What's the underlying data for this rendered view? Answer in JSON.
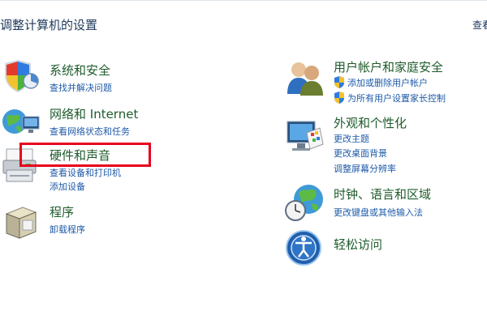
{
  "header": {
    "title": "调整计算机的设置",
    "view_by": "查看"
  },
  "left": [
    {
      "title": "系统和安全",
      "links": [
        "查找并解决问题"
      ],
      "icon": "security-shield-icon"
    },
    {
      "title": "网络和 Internet",
      "links": [
        "查看网络状态和任务"
      ],
      "icon": "network-globe-icon"
    },
    {
      "title": "硬件和声音",
      "links": [
        "查看设备和打印机",
        "添加设备"
      ],
      "icon": "printer-icon"
    },
    {
      "title": "程序",
      "links": [
        "卸载程序"
      ],
      "icon": "programs-box-icon"
    }
  ],
  "right": [
    {
      "title": "用户帐户和家庭安全",
      "links": [
        "添加或删除用户帐户",
        "为所有用户设置家长控制"
      ],
      "icon": "users-icon"
    },
    {
      "title": "外观和个性化",
      "links": [
        "更改主题",
        "更改桌面背景",
        "调整屏幕分辨率"
      ],
      "icon": "monitor-palette-icon"
    },
    {
      "title": "时钟、语言和区域",
      "links": [
        "更改键盘或其他输入法"
      ],
      "icon": "clock-globe-icon"
    },
    {
      "title": "轻松访问",
      "links": [],
      "icon": "ease-of-access-icon"
    }
  ],
  "highlight_color": "#e8001c"
}
